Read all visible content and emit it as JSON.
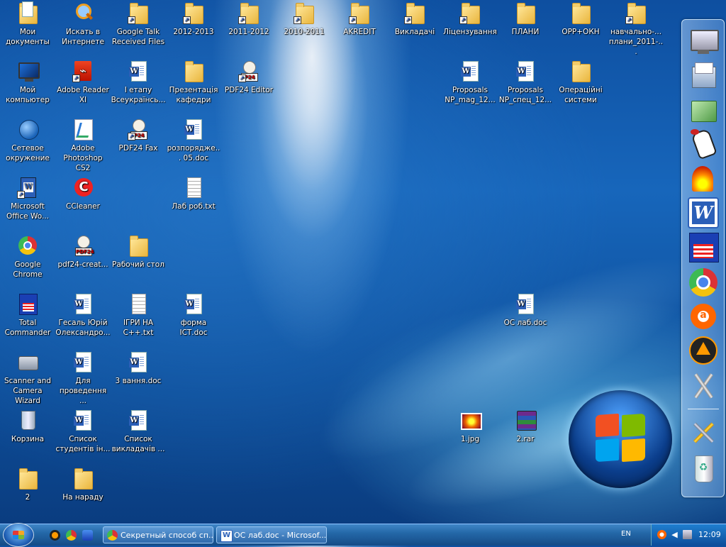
{
  "desktop": {
    "icons": [
      {
        "label": "Мои документы"
      },
      {
        "label": "Искать в Интернете"
      },
      {
        "label": "Google Talk Received Files"
      },
      {
        "label": "2012-2013"
      },
      {
        "label": "2011-2012"
      },
      {
        "label": "2010-2011"
      },
      {
        "label": "AKREDIT"
      },
      {
        "label": "Викладачі"
      },
      {
        "label": "Ліцензування"
      },
      {
        "label": "ПЛАНИ"
      },
      {
        "label": "ОРР+ОКН"
      },
      {
        "label": "навчально-... плани_2011-..."
      },
      {
        "label": "Мой компьютер"
      },
      {
        "label": "Adobe Reader XI"
      },
      {
        "label": "І етапу Всеукраїнсь..."
      },
      {
        "label": "Презентація кафедри"
      },
      {
        "label": "PDF24 Editor"
      },
      {
        "label": "Proposals NP_mag_12..."
      },
      {
        "label": "Proposals NP_спец_12..."
      },
      {
        "label": "Операційні системи"
      },
      {
        "label": "Сетевое окружение"
      },
      {
        "label": "Adobe Photoshop CS2"
      },
      {
        "label": "PDF24 Fax"
      },
      {
        "label": "розпорядже... 05.doc"
      },
      {
        "label": "Microsoft Office Wo..."
      },
      {
        "label": "CCleaner"
      },
      {
        "label": "Лаб роб.txt"
      },
      {
        "label": "Google Chrome"
      },
      {
        "label": "pdf24-creat..."
      },
      {
        "label": "Рабочий стол"
      },
      {
        "label": "Total Commander"
      },
      {
        "label": "Гесаль Юрій Олександро..."
      },
      {
        "label": "ІГРИ НА C++.txt"
      },
      {
        "label": "форма ІСТ.doc"
      },
      {
        "label": "ОС лаб.doc"
      },
      {
        "label": "Scanner and Camera Wizard"
      },
      {
        "label": "Для проведення ..."
      },
      {
        "label": "3 вання.doc"
      },
      {
        "label": "Корзина"
      },
      {
        "label": "Список студентів ін..."
      },
      {
        "label": "Список викладачів ..."
      },
      {
        "label": "1.jpg"
      },
      {
        "label": "2.rar"
      },
      {
        "label": "2"
      },
      {
        "label": "На нараду"
      }
    ]
  },
  "dock": {
    "items": [
      {
        "icon": "computer-icon"
      },
      {
        "icon": "documents-icon"
      },
      {
        "icon": "green-folder-icon"
      },
      {
        "icon": "hand-pointer-icon"
      },
      {
        "icon": "fire-tools-icon"
      },
      {
        "icon": "word-icon"
      },
      {
        "icon": "total-commander-icon"
      },
      {
        "icon": "chrome-icon"
      },
      {
        "icon": "avast-icon"
      },
      {
        "icon": "aimp-icon"
      },
      {
        "icon": "tools-icon"
      },
      {
        "icon": "settings-tools-icon"
      },
      {
        "icon": "recycle-bin-icon"
      }
    ]
  },
  "taskbar": {
    "tasks": [
      {
        "label": "Секретный способ сп...",
        "icon": "chrome-icon"
      },
      {
        "label": "ОС лаб.doc - Microsof...",
        "icon": "word-icon"
      }
    ],
    "language": "EN",
    "clock": "12:09"
  },
  "colors": {
    "taskbar": "#2468a8",
    "folder": "#e9b53d",
    "word_blue": "#2b5fb8"
  }
}
